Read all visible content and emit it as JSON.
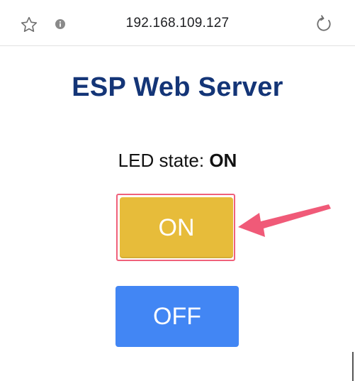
{
  "browser": {
    "url": "192.168.109.127",
    "icons": {
      "bookmark": "star-icon",
      "site_info": "info-icon",
      "reload": "reload-icon"
    }
  },
  "page": {
    "title": "ESP Web Server",
    "led_label": "LED state:",
    "led_value": "ON",
    "buttons": {
      "on_label": "ON",
      "off_label": "OFF"
    }
  },
  "colors": {
    "title": "#143577",
    "on_button": "#e7bc3a",
    "off_button": "#4286f4",
    "highlight": "#f0607a"
  }
}
